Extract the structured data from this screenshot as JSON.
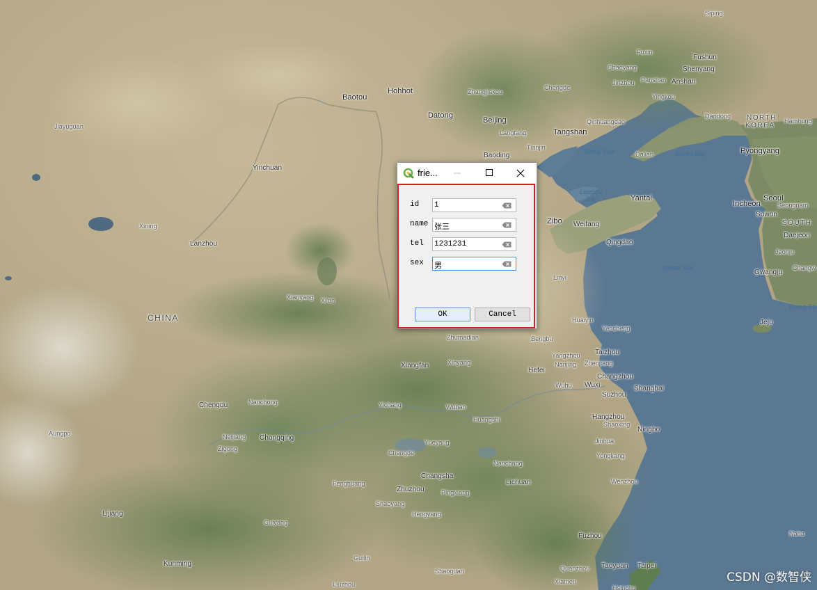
{
  "map": {
    "colors": {
      "sea": "#5d7a95",
      "land": "#b9ae8c",
      "green": "#7d8f68"
    },
    "labels": [
      {
        "text": "Siping",
        "cls": "faint"
      },
      {
        "text": "Fuxin",
        "cls": "faint"
      },
      {
        "text": "Fushun",
        "cls": ""
      },
      {
        "text": "Chaoyang",
        "cls": "faint"
      },
      {
        "text": "Panshan",
        "cls": "faint"
      },
      {
        "text": "Shenyang",
        "cls": ""
      },
      {
        "text": "Jinzhou",
        "cls": "faint"
      },
      {
        "text": "Anshan",
        "cls": ""
      },
      {
        "text": "Yingkou",
        "cls": "faint"
      },
      {
        "text": "Dandong",
        "cls": "faint"
      },
      {
        "text": "NORTH",
        "cls": "region"
      },
      {
        "text": "KOREA",
        "cls": "region"
      },
      {
        "text": "Hamhung",
        "cls": "faint"
      },
      {
        "text": "Hohhot",
        "cls": ""
      },
      {
        "text": "Zhangjiakou",
        "cls": "faint"
      },
      {
        "text": "Chengde",
        "cls": "faint"
      },
      {
        "text": "Baotou",
        "cls": ""
      },
      {
        "text": "Datong",
        "cls": ""
      },
      {
        "text": "Beijing",
        "cls": ""
      },
      {
        "text": "Qinhuangdao",
        "cls": "faint"
      },
      {
        "text": "Langfang",
        "cls": "faint"
      },
      {
        "text": "Tangshan",
        "cls": ""
      },
      {
        "text": "Tianjin",
        "cls": "faint"
      },
      {
        "text": "Bohai Sea",
        "cls": "sea"
      },
      {
        "text": "Dalian",
        "cls": "faint"
      },
      {
        "text": "Korea Bay",
        "cls": "sea"
      },
      {
        "text": "Pyongyang",
        "cls": ""
      },
      {
        "text": "Jiayuguan",
        "cls": "faint"
      },
      {
        "text": "Baoding",
        "cls": ""
      },
      {
        "text": "Yinchuan",
        "cls": ""
      },
      {
        "text": "Laizhou",
        "cls": "sea"
      },
      {
        "text": "Bay",
        "cls": "sea"
      },
      {
        "text": "Yantai",
        "cls": ""
      },
      {
        "text": "Incheon",
        "cls": ""
      },
      {
        "text": "Seoul",
        "cls": ""
      },
      {
        "text": "Seongnam",
        "cls": "faint"
      },
      {
        "text": "Suwon",
        "cls": ""
      },
      {
        "text": "SOUTH",
        "cls": "region"
      },
      {
        "text": "Daejeon",
        "cls": ""
      },
      {
        "text": "Jeonju",
        "cls": "faint"
      },
      {
        "text": "Zibo",
        "cls": ""
      },
      {
        "text": "Weifang",
        "cls": ""
      },
      {
        "text": "Xining",
        "cls": "faint"
      },
      {
        "text": "Qingdao",
        "cls": ""
      },
      {
        "text": "Lanzhou",
        "cls": ""
      },
      {
        "text": "Linyi",
        "cls": "faint"
      },
      {
        "text": "Yellow Sea",
        "cls": "sea"
      },
      {
        "text": "Gwangju",
        "cls": ""
      },
      {
        "text": "Changw",
        "cls": "faint"
      },
      {
        "text": "Xianyang",
        "cls": "faint"
      },
      {
        "text": "Xi'an",
        "cls": "faint"
      },
      {
        "text": "Korea Stra",
        "cls": "sea"
      },
      {
        "text": "CHINA",
        "cls": "region"
      },
      {
        "text": "Huaiyin",
        "cls": "faint"
      },
      {
        "text": "Yancheng",
        "cls": "faint"
      },
      {
        "text": "Jeju",
        "cls": ""
      },
      {
        "text": "Zhumadian",
        "cls": "faint"
      },
      {
        "text": "Bengbu",
        "cls": "faint"
      },
      {
        "text": "Taizhou",
        "cls": ""
      },
      {
        "text": "Yangzhou",
        "cls": "faint"
      },
      {
        "text": "Xiangfan",
        "cls": ""
      },
      {
        "text": "Xinyang",
        "cls": "faint"
      },
      {
        "text": "Nanjing",
        "cls": "faint"
      },
      {
        "text": "Zhenjiang",
        "cls": "faint"
      },
      {
        "text": "Hefei",
        "cls": ""
      },
      {
        "text": "Changzhou",
        "cls": ""
      },
      {
        "text": "Wuhu",
        "cls": "faint"
      },
      {
        "text": "Wuxi",
        "cls": ""
      },
      {
        "text": "Shanghai",
        "cls": ""
      },
      {
        "text": "Suzhou",
        "cls": ""
      },
      {
        "text": "Chengdu",
        "cls": ""
      },
      {
        "text": "Nanchong",
        "cls": "faint"
      },
      {
        "text": "Yichang",
        "cls": "faint"
      },
      {
        "text": "Wuhan",
        "cls": "faint"
      },
      {
        "text": "Hangzhou",
        "cls": ""
      },
      {
        "text": "Shaoxing",
        "cls": "faint"
      },
      {
        "text": "Huangshi",
        "cls": "faint"
      },
      {
        "text": "Ningbo",
        "cls": ""
      },
      {
        "text": "Neijiang",
        "cls": "faint"
      },
      {
        "text": "Chongqing",
        "cls": ""
      },
      {
        "text": "Zigong",
        "cls": "faint"
      },
      {
        "text": "Yueyang",
        "cls": "faint"
      },
      {
        "text": "Jinhua",
        "cls": "faint"
      },
      {
        "text": "Changde",
        "cls": "faint"
      },
      {
        "text": "Yongkang",
        "cls": "faint"
      },
      {
        "text": "Nanchang",
        "cls": "faint"
      },
      {
        "text": "Changsha",
        "cls": ""
      },
      {
        "text": "Fenghuang",
        "cls": "faint"
      },
      {
        "text": "Lichuan",
        "cls": ""
      },
      {
        "text": "Wenzhou",
        "cls": "faint"
      },
      {
        "text": "Zhuzhou",
        "cls": ""
      },
      {
        "text": "Pingxiang",
        "cls": "faint"
      },
      {
        "text": "Shaoyang",
        "cls": "faint"
      },
      {
        "text": "Lijiang",
        "cls": ""
      },
      {
        "text": "Hengyang",
        "cls": "faint"
      },
      {
        "text": "Guiyang",
        "cls": "faint"
      },
      {
        "text": "Fuzhou",
        "cls": ""
      },
      {
        "text": "Naha",
        "cls": "faint"
      },
      {
        "text": "Kunming",
        "cls": ""
      },
      {
        "text": "Guilin",
        "cls": "faint"
      },
      {
        "text": "Taoyuan",
        "cls": ""
      },
      {
        "text": "Taipei",
        "cls": ""
      },
      {
        "text": "Quanzhou",
        "cls": "faint"
      },
      {
        "text": "Shaoguan",
        "cls": "faint"
      },
      {
        "text": "Xiamen",
        "cls": "faint"
      },
      {
        "text": "Liuzhou",
        "cls": "faint"
      },
      {
        "text": "Hsinchu",
        "cls": "faint"
      },
      {
        "text": "Aungpo",
        "cls": "faint"
      }
    ]
  },
  "watermark": "CSDN @数智侠",
  "dialog": {
    "title": "frie...",
    "fields": [
      {
        "label": "id",
        "value": "1"
      },
      {
        "label": "name",
        "value": "张三"
      },
      {
        "label": "tel",
        "value": "1231231"
      },
      {
        "label": "sex",
        "value": "男"
      }
    ],
    "ok_label": "OK",
    "cancel_label": "Cancel",
    "colors": {
      "highlight_border": "#d21f1f",
      "focus_border": "#4a90d9",
      "app_icon": "#6ab04c"
    }
  }
}
